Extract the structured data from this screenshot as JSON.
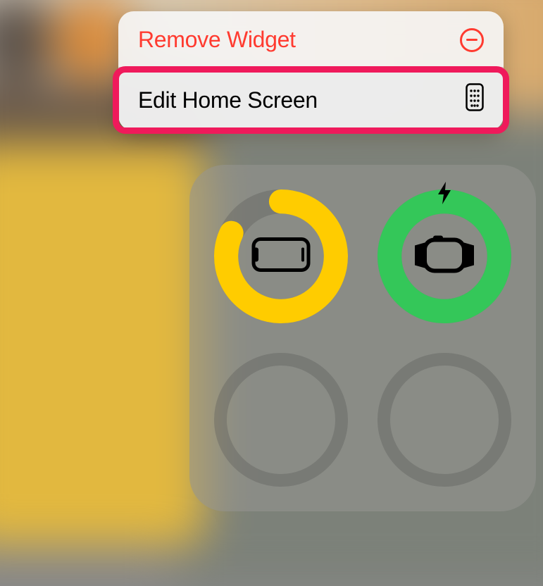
{
  "menu": {
    "remove_label": "Remove Widget",
    "edit_label": "Edit Home Screen"
  },
  "widget": {
    "devices": [
      {
        "type": "iphone",
        "percent": 82,
        "color": "#ffcc00",
        "charging": false
      },
      {
        "type": "applewatch",
        "percent": 100,
        "color": "#34c759",
        "charging": true
      }
    ]
  },
  "colors": {
    "destructive": "#ff3b30",
    "highlight": "#ef1a5b"
  }
}
